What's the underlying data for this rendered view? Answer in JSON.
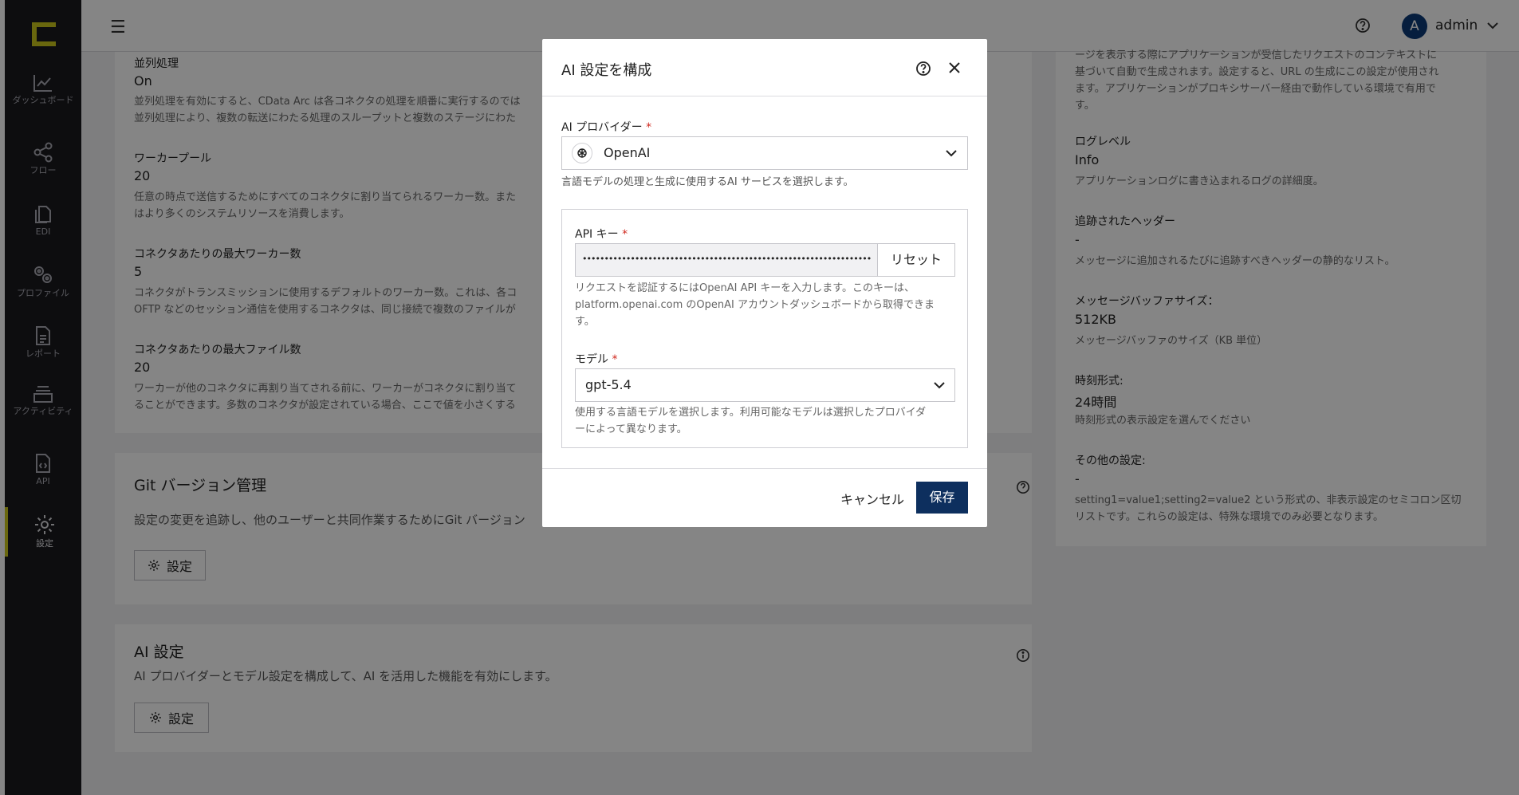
{
  "sidebar": {
    "items": [
      {
        "label": "ダッシュボード",
        "icon": "chart-line-icon"
      },
      {
        "label": "フロー",
        "icon": "share-nodes-icon"
      },
      {
        "label": "EDI",
        "icon": "documents-icon"
      },
      {
        "label": "プロファイル",
        "icon": "gears-icon"
      },
      {
        "label": "レポート",
        "icon": "report-icon"
      },
      {
        "label": "アクティビティ",
        "icon": "activity-icon"
      },
      {
        "label": "API",
        "icon": "api-file-icon"
      },
      {
        "label": "設定",
        "icon": "settings-gear-icon",
        "active": true
      }
    ]
  },
  "topbar": {
    "user_initial": "A",
    "user_name": "admin"
  },
  "left_card": {
    "fields": [
      {
        "label": "並列処理",
        "value": "On",
        "desc": [
          "並列処理を有効にすると、CData Arc は各コネクタの処理を順番に実行するのでは",
          "並列処理により、複数の転送にわたる処理のスループットと複数のステージにわた"
        ]
      },
      {
        "label": "ワーカープール",
        "value": "20",
        "desc": [
          "任意の時点で送信するためにすべてのコネクタに割り当てられるワーカー数。また",
          "はより多くのシステムリソースを消費します。"
        ]
      },
      {
        "label": "コネクタあたりの最大ワーカー数",
        "value": "5",
        "desc": [
          "コネクタがトランスミッションに使用するデフォルトのワーカー数。これは、各コ",
          "OFTP などのセッション通信を使用するコネクタは、同じ接続で複数のファイルが"
        ]
      },
      {
        "label": "コネクタあたりの最大ファイル数",
        "value": "20",
        "desc": [
          "ワーカーが他のコネクタに再割り当てされる前に、ワーカーがコネクタに割り当て",
          "ることができます。多数のコネクタが設定されている場合、ここで値を小さくする"
        ]
      }
    ]
  },
  "git_section": {
    "title": "Git バージョン管理",
    "desc": "設定の変更を追跡し、他のユーザーと共同作業するためにGit バージョン",
    "button_label": "設定"
  },
  "ai_section": {
    "title": "AI 設定",
    "desc": "AI プロバイダーとモデル設定を構成して、AI を活用した機能を有効にします。",
    "button_label": "設定"
  },
  "right_card": {
    "top_desc": [
      "ージを表示する際にアプリケーションが受信したリクエストのコンテキストに",
      "基づいて自動で生成されます。設定すると、URL の生成にこの設定が使用され",
      "ます。アプリケーションがプロキシサーバー経由で動作している環境で有用で",
      "す。"
    ],
    "fields": [
      {
        "label": "ログレベル",
        "value": "Info",
        "desc": [
          "アプリケーションログに書き込まれるログの詳細度。"
        ]
      },
      {
        "label": "追跡されたヘッダー",
        "value": "-",
        "desc": [
          "メッセージに追加されるたびに追跡すべきヘッダーの静的なリスト。"
        ]
      },
      {
        "label": "メッセージバッファサイズ：",
        "value": "512KB",
        "desc": [
          "メッセージバッファのサイズ（KB 単位）"
        ]
      },
      {
        "label": "時刻形式:",
        "value": "24時間",
        "desc": [
          "時刻形式の表示設定を選んでください"
        ]
      },
      {
        "label": "その他の設定:",
        "value": "-",
        "desc": [
          "setting1=value1;setting2=value2 という形式の、非表示設定のセミコロン区切",
          "リストです。これらの設定は、特殊な環境でのみ必要となります。"
        ]
      }
    ]
  },
  "dialog": {
    "title": "AI 設定を構成",
    "provider_label": "AI プロバイダー",
    "provider_value": "OpenAI",
    "provider_help": "言語モデルの処理と生成に使用するAI サービスを選択します。",
    "api_key_label": "API キー",
    "api_key_value": "••••••••••••••••••••••••••••••••••••••••••••••••••••••••••••••••••",
    "api_key_reset": "リセット",
    "api_key_help": [
      "リクエストを認証するにはOpenAI API キーを入力します。このキーは、",
      "platform.openai.com のOpenAI アカウントダッシュボードから取得できま",
      "す。"
    ],
    "model_label": "モデル",
    "model_value": "gpt-5.4",
    "model_help": [
      "使用する言語モデルを選択します。利用可能なモデルは選択したプロバイダ",
      "ーによって異なります。"
    ],
    "cancel_label": "キャンセル",
    "save_label": "保存",
    "required_mark": "*"
  },
  "colors": {
    "sidebar_bg": "#1a1a1e",
    "accent_yellow": "#c9c61c",
    "primary_button": "#0d2f5e",
    "avatar_bg": "#0d3a78",
    "required": "#d0281e"
  }
}
